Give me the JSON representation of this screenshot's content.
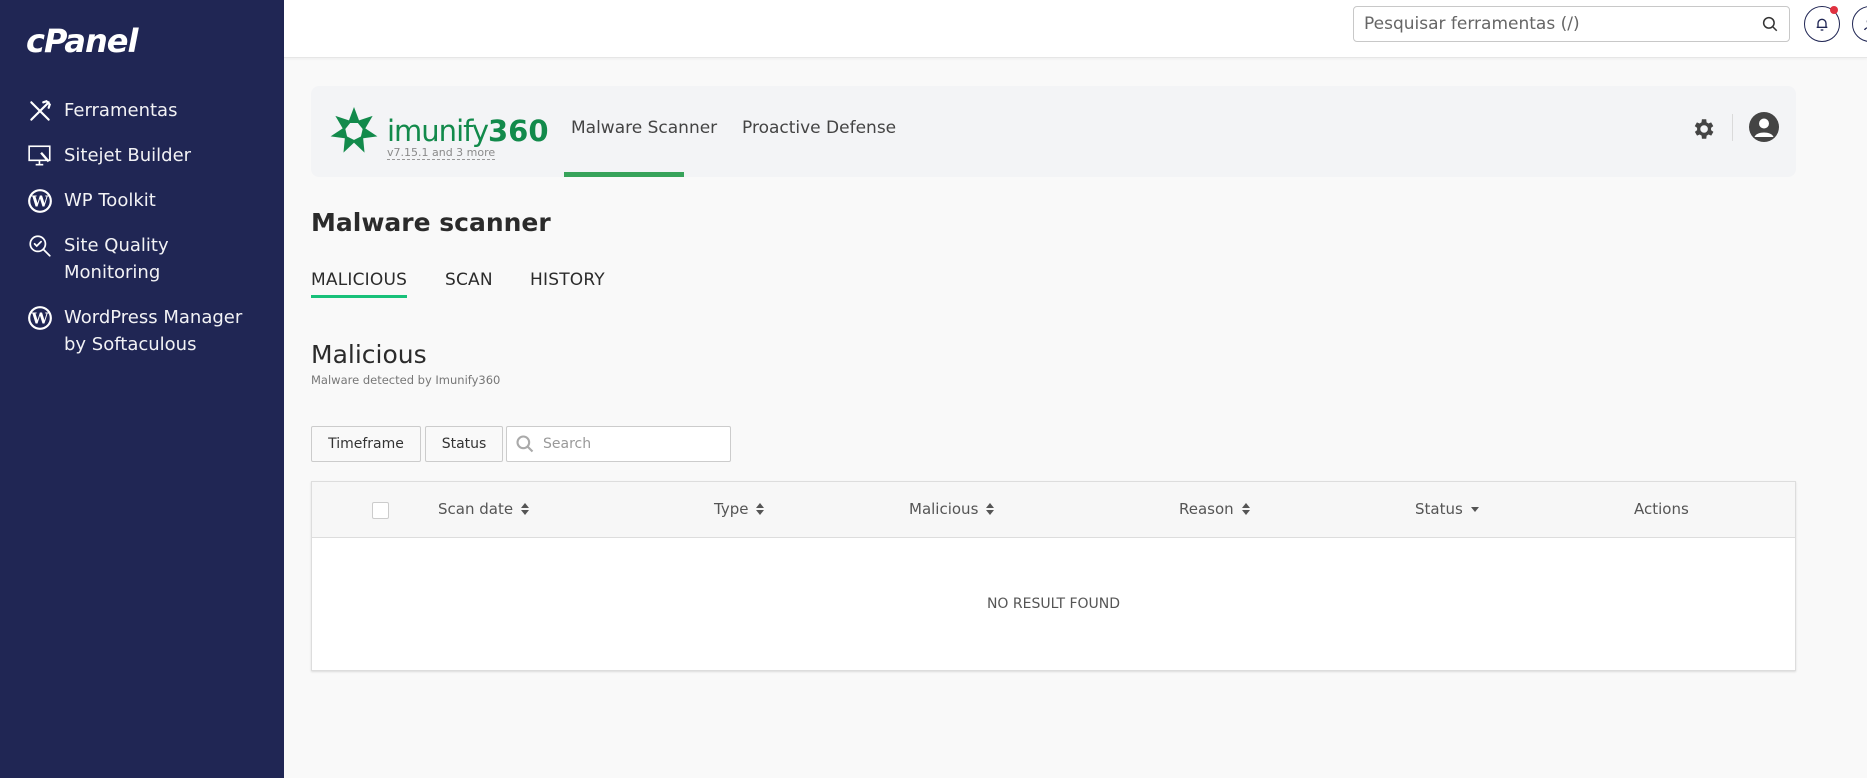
{
  "sidebar": {
    "logo": "cPanel",
    "items": [
      {
        "label": "Ferramentas",
        "icon": "tools-icon"
      },
      {
        "label": "Sitejet Builder",
        "icon": "monitor-brush-icon"
      },
      {
        "label": "WP Toolkit",
        "icon": "wordpress-icon"
      },
      {
        "label": "Site Quality",
        "label2": "Monitoring",
        "icon": "magnifier-check-icon"
      },
      {
        "label": "WordPress Manager",
        "label2": "by Softaculous",
        "icon": "wordpress-icon"
      }
    ]
  },
  "topbar": {
    "search_placeholder": "Pesquisar ferramentas (/)",
    "notification_dot_color": "#e03140"
  },
  "imunify": {
    "brand": "imunify",
    "brand_num": "360",
    "version": "v7.15.1 and 3 more",
    "tabs": [
      {
        "label": "Malware Scanner",
        "active": true
      },
      {
        "label": "Proactive Defense",
        "active": false
      }
    ],
    "accent": "#37a35a"
  },
  "page": {
    "title": "Malware scanner",
    "subtabs": [
      {
        "label": "MALICIOUS",
        "active": true
      },
      {
        "label": "SCAN",
        "active": false
      },
      {
        "label": "HISTORY",
        "active": false
      }
    ],
    "section_title": "Malicious",
    "section_subtitle": "Malware detected by Imunify360"
  },
  "filters": {
    "timeframe": "Timeframe",
    "status": "Status",
    "search_placeholder": "Search"
  },
  "table": {
    "columns": [
      {
        "label": "Scan date",
        "sort": "both"
      },
      {
        "label": "Type",
        "sort": "both"
      },
      {
        "label": "Malicious",
        "sort": "both"
      },
      {
        "label": "Reason",
        "sort": "both"
      },
      {
        "label": "Status",
        "sort": "down"
      },
      {
        "label": "Actions",
        "sort": "none"
      }
    ],
    "rows": [],
    "empty_text": "NO RESULT FOUND"
  }
}
